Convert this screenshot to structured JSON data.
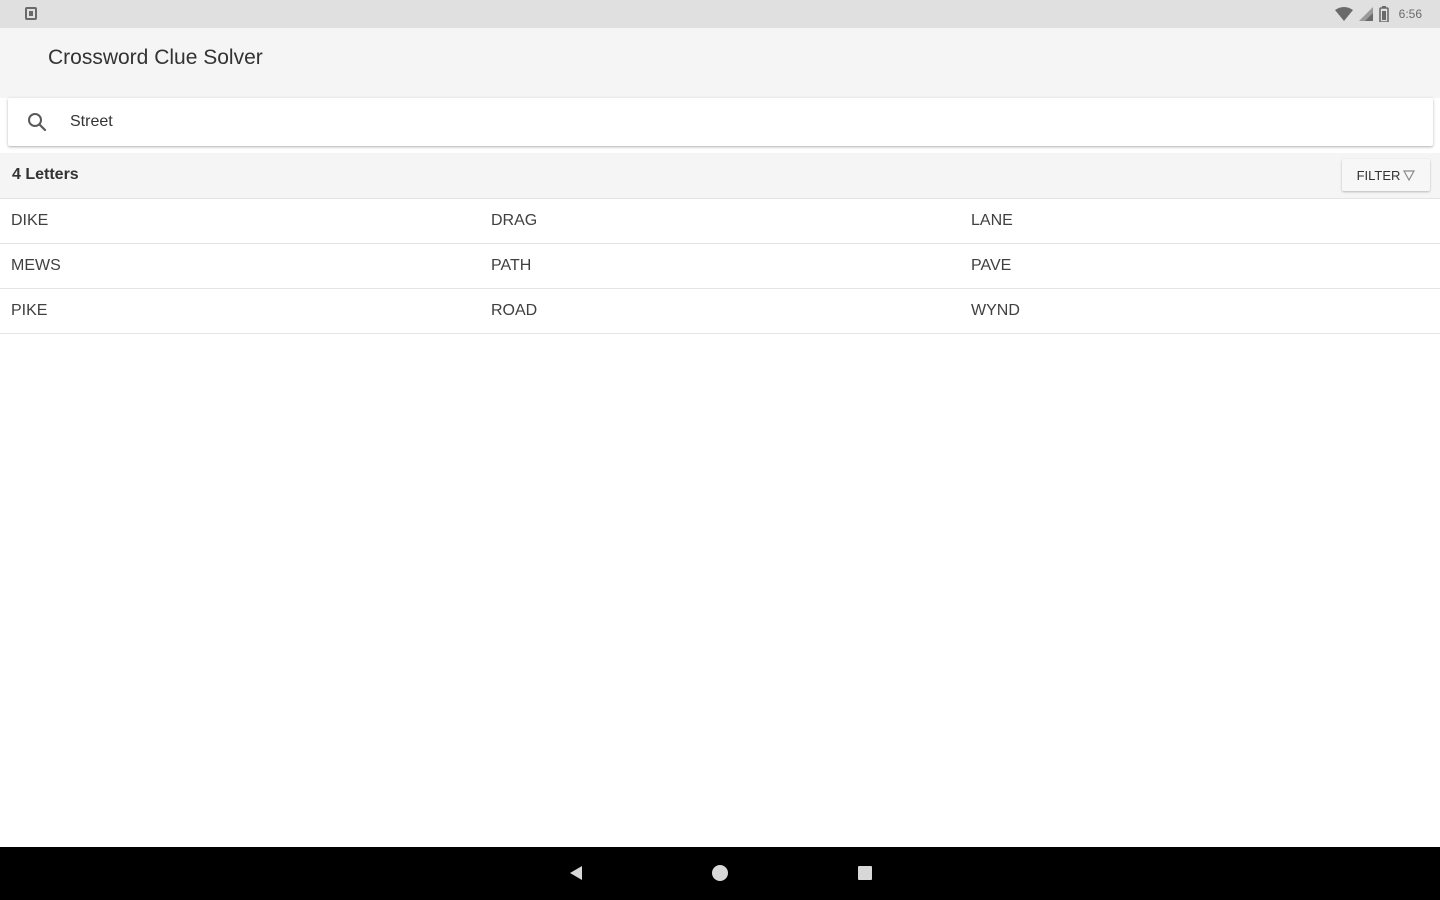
{
  "status_bar": {
    "time": "6:56",
    "icons": [
      "notification-icon",
      "wifi-icon",
      "signal-icon",
      "battery-icon"
    ]
  },
  "app_bar": {
    "title": "Crossword Clue Solver"
  },
  "search": {
    "icon": "search-icon",
    "value": "Street"
  },
  "results_header": {
    "title": "4 Letters",
    "filter_label": "FILTER",
    "filter_icon": "filter-icon"
  },
  "results": {
    "rows": [
      [
        "DIKE",
        "DRAG",
        "LANE"
      ],
      [
        "MEWS",
        "PATH",
        "PAVE"
      ],
      [
        "PIKE",
        "ROAD",
        "WYND"
      ]
    ]
  },
  "nav_bar": {
    "icons": [
      "back-icon",
      "home-icon",
      "recents-icon"
    ]
  },
  "colors": {
    "status_bar_bg": "#e0e0e0",
    "app_bar_bg": "#f5f5f5",
    "divider": "#e4e4e4",
    "text_primary": "#333333",
    "nav_bar_bg": "#000000"
  }
}
